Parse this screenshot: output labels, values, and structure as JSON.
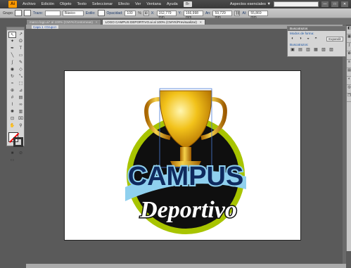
{
  "menubar": {
    "app_icon": "Ai",
    "items": [
      "Archivo",
      "Edición",
      "Objeto",
      "Texto",
      "Seleccionar",
      "Efecto",
      "Ver",
      "Ventana",
      "Ayuda"
    ],
    "bridge_label": "Br",
    "workspace": "Aspectos esenciales ▼",
    "search_placeholder": "",
    "controls": [
      "—",
      "□",
      "✕"
    ]
  },
  "controlbar": {
    "group_label": "Grupo",
    "trazo_label": "Trazo:",
    "stroke_style": "Básico",
    "estilo_label": "Estilo:",
    "opacity_label": "Opacidad:",
    "opacity_value": "100",
    "percent": "%",
    "x_label": "X:",
    "x_value": "152,779 mm",
    "y_label": "Y:",
    "y_value": "166,998 mm",
    "w_label": "An:",
    "w_value": "59,729 mm",
    "h_label": "Al:",
    "h_value": "55,869 mm"
  },
  "tabs": [
    {
      "label": "marco logo.ai* al 100% (CMYK/Contorneas)",
      "active": false
    },
    {
      "label": "LOGO CAMPUS DEPORTIVO.ai al 100% (CMYK/Previsualizar)",
      "active": true
    }
  ],
  "canvas": {
    "layer_tag": "Capa 1",
    "group_tag": "<Grupo>"
  },
  "logo": {
    "title": "CAMPUS",
    "subtitle": "Deportivo"
  },
  "rpanel": {
    "title": "Buscatrazos",
    "mode_label": "Modos de forma:",
    "expand_label": "Expandir",
    "pathfinder_label": "Buscatrazos:"
  },
  "colors": {
    "accent_green": "#a8c400",
    "dark_circle": "#0f0f0f",
    "text_light_blue": "#8fd0ee",
    "gold": "#e8a800"
  }
}
